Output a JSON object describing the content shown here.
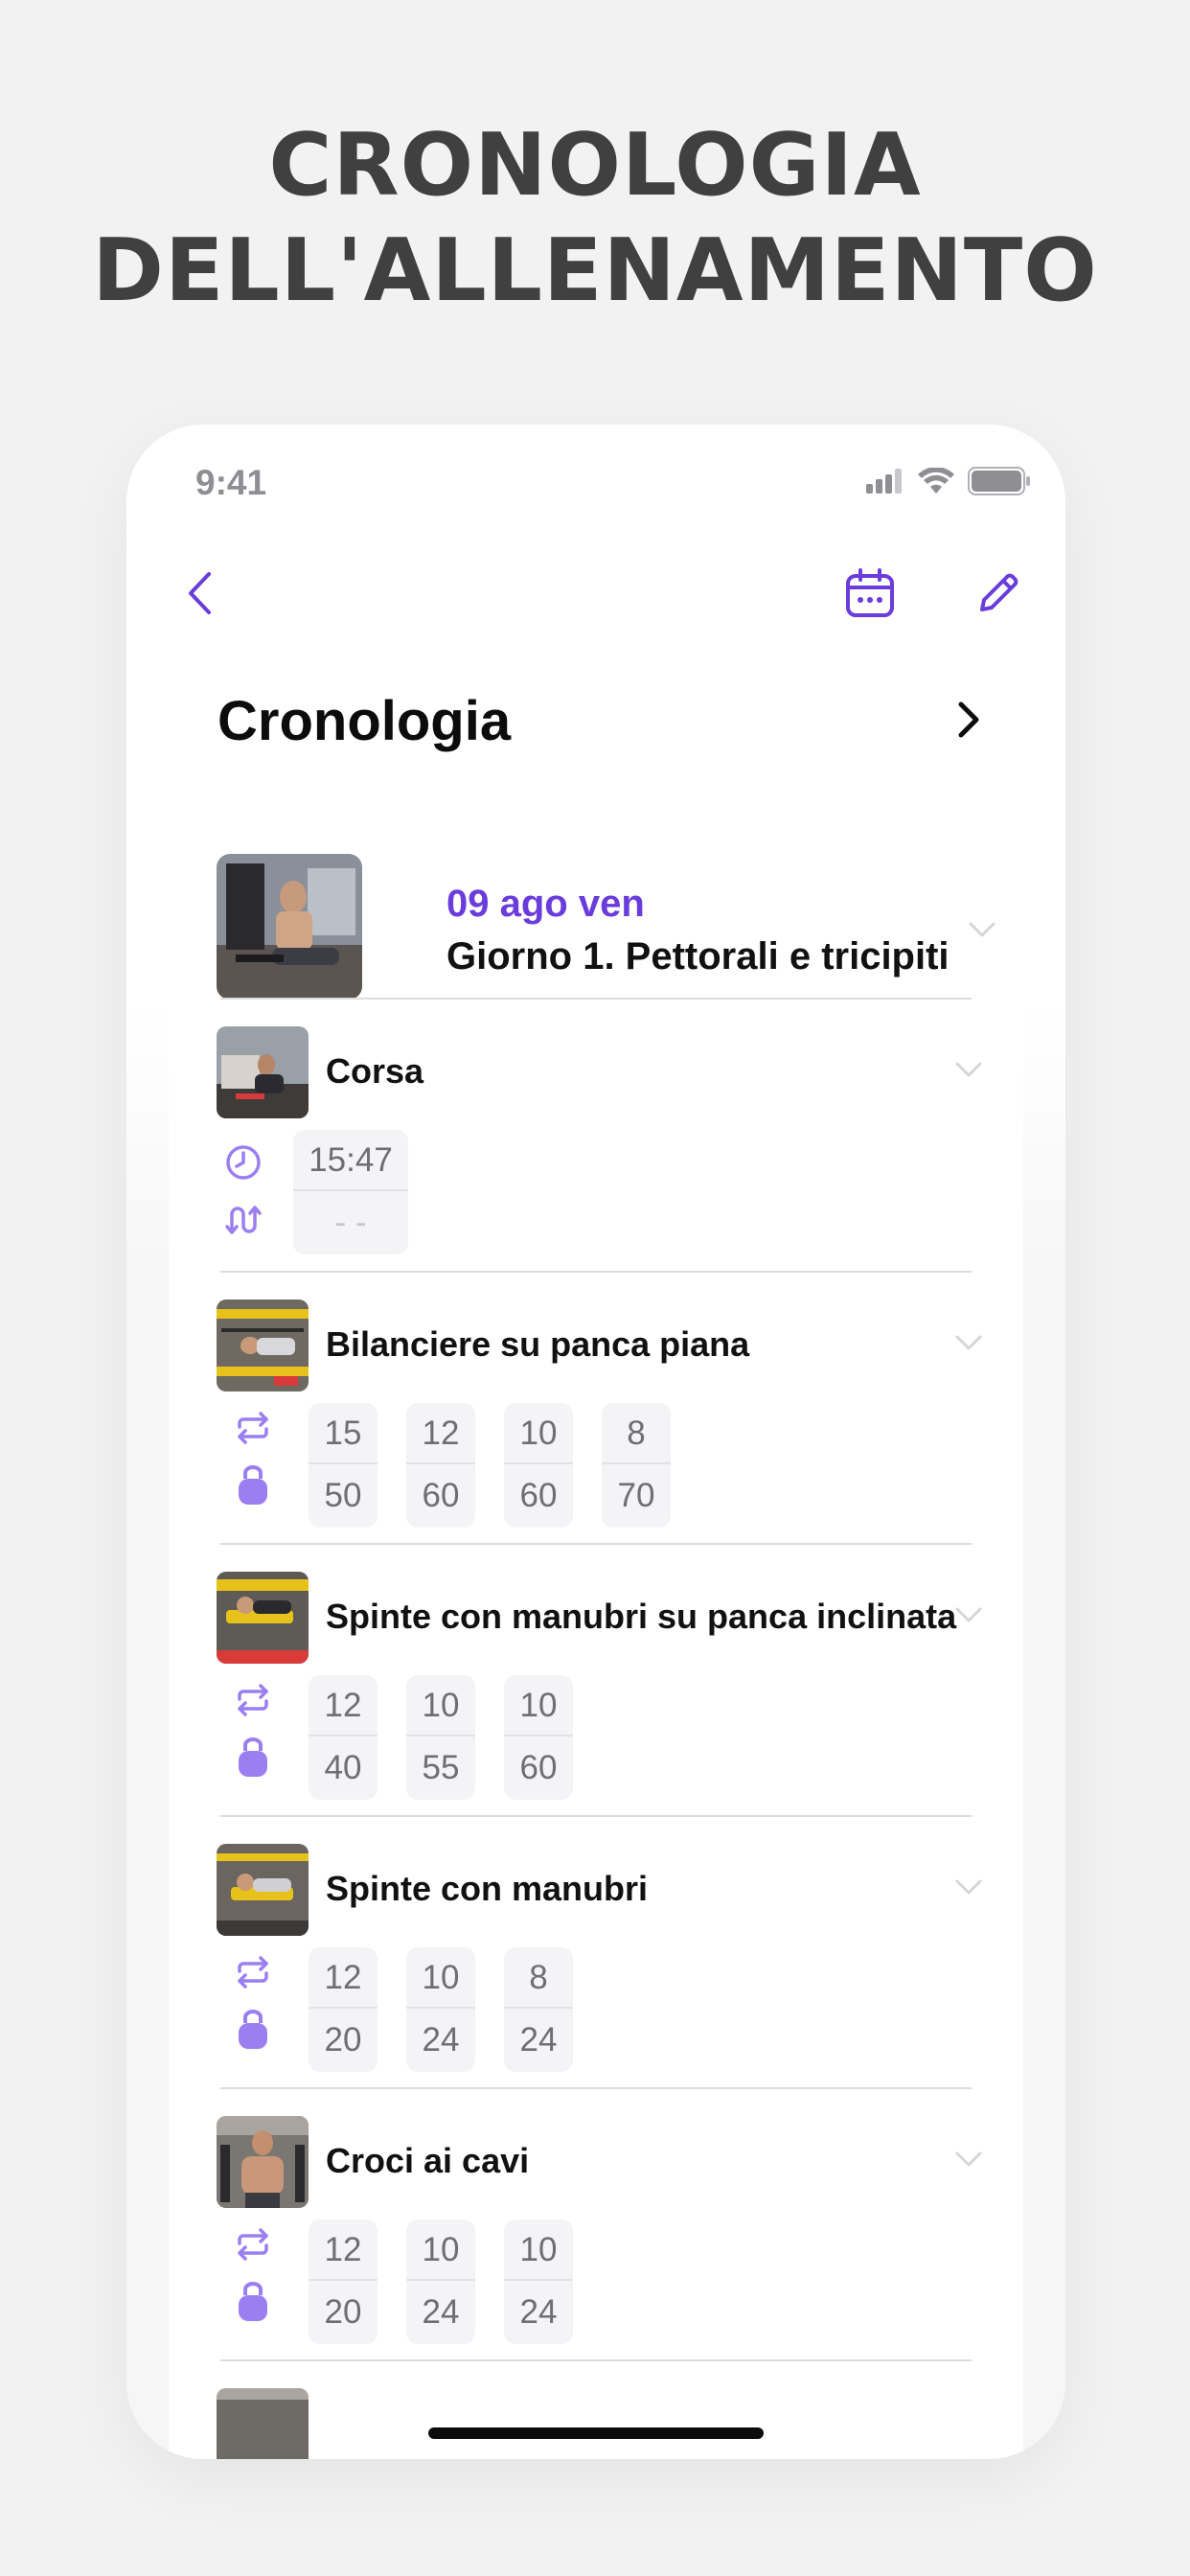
{
  "headline": {
    "line1": "CRONOLOGIA",
    "line2": "DELL'ALLENAMENTO"
  },
  "status_bar": {
    "time": "9:41"
  },
  "nav": {
    "back_icon": "chevron-left-icon",
    "calendar_icon": "calendar-icon",
    "edit_icon": "pencil-icon"
  },
  "page": {
    "title": "Cronologia",
    "next_icon": "chevron-right-icon"
  },
  "session": {
    "date": "09 ago ven",
    "name": "Giorno 1. Pettorali e tricipiti"
  },
  "exercises": [
    {
      "name": "Corsa",
      "type": "cardio",
      "sets": [
        {
          "top": "15:47",
          "bottom": "- -"
        }
      ]
    },
    {
      "name": "Bilanciere su panca piana",
      "type": "strength",
      "sets": [
        {
          "top": "15",
          "bottom": "50"
        },
        {
          "top": "12",
          "bottom": "60"
        },
        {
          "top": "10",
          "bottom": "60"
        },
        {
          "top": "8",
          "bottom": "70"
        }
      ]
    },
    {
      "name": "Spinte con manubri su panca inclinata",
      "type": "strength",
      "sets": [
        {
          "top": "12",
          "bottom": "40"
        },
        {
          "top": "10",
          "bottom": "55"
        },
        {
          "top": "10",
          "bottom": "60"
        }
      ]
    },
    {
      "name": "Spinte con manubri",
      "type": "strength",
      "sets": [
        {
          "top": "12",
          "bottom": "20"
        },
        {
          "top": "10",
          "bottom": "24"
        },
        {
          "top": "8",
          "bottom": "24"
        }
      ]
    },
    {
      "name": "Croci ai cavi",
      "type": "strength",
      "sets": [
        {
          "top": "12",
          "bottom": "20"
        },
        {
          "top": "10",
          "bottom": "24"
        },
        {
          "top": "10",
          "bottom": "24"
        }
      ]
    }
  ],
  "colors": {
    "accent": "#6a3cdb",
    "icon_purple": "#9b7ff0",
    "headline": "#404041"
  }
}
